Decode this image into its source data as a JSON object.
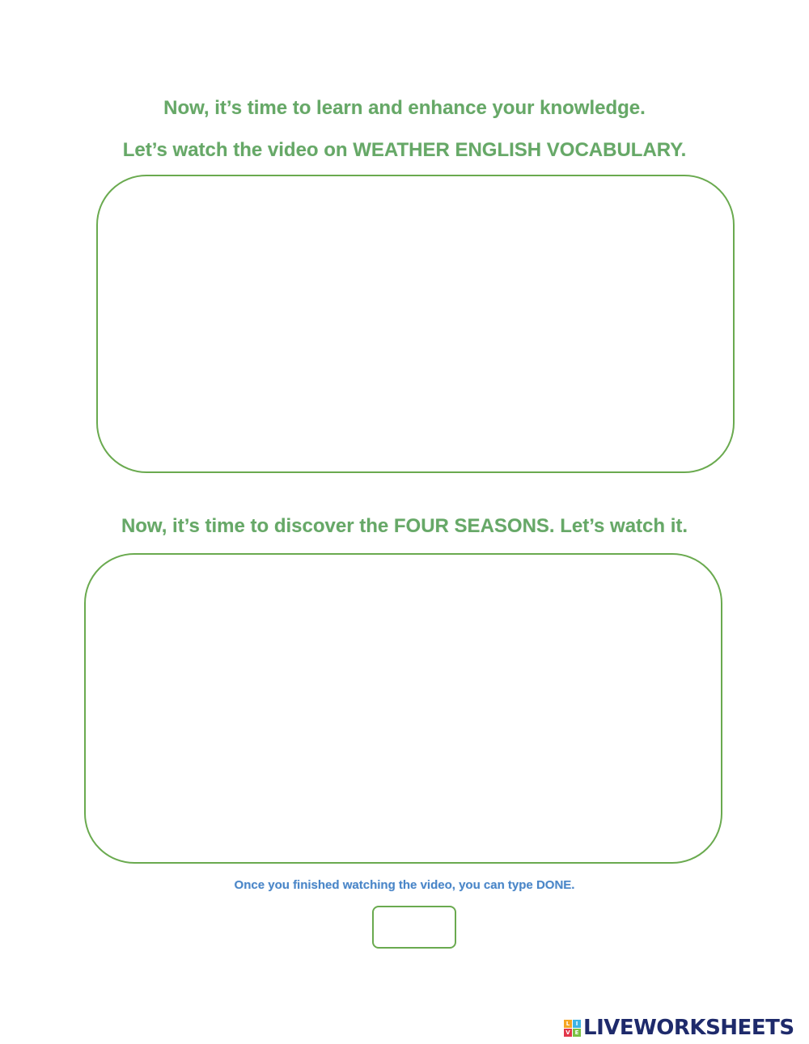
{
  "headings": {
    "intro": "Now, it’s time to learn and enhance your knowledge.",
    "video1_prompt": "Let’s watch the video on WEATHER ENGLISH VOCABULARY.",
    "video2_prompt": "Now, it’s time to discover the FOUR SEASONS. Let’s watch it."
  },
  "instruction": "Once you finished watching the video, you can type DONE.",
  "answer_field": {
    "value": ""
  },
  "logo": {
    "mark_letters": [
      "L",
      "I",
      "V",
      "E"
    ],
    "text": "LIVEWORKSHEETS"
  },
  "colors": {
    "heading": "#66a867",
    "instruction": "#4a86c8",
    "box_border": "#6aaa4f",
    "logo_text": "#1e2a6b"
  }
}
